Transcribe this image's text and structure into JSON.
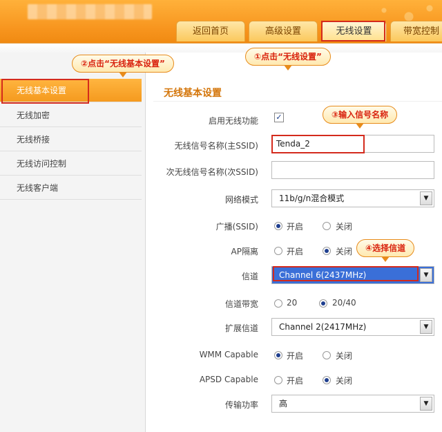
{
  "nav": {
    "tabs": [
      {
        "label": "返回首页"
      },
      {
        "label": "高级设置"
      },
      {
        "label": "无线设置"
      },
      {
        "label": "带宽控制"
      }
    ]
  },
  "sidebar": {
    "items": [
      {
        "label": "无线基本设置"
      },
      {
        "label": "无线加密"
      },
      {
        "label": "无线桥接"
      },
      {
        "label": "无线访问控制"
      },
      {
        "label": "无线客户端"
      }
    ]
  },
  "form": {
    "title": "无线基本设置",
    "enable_wireless": {
      "label": "启用无线功能",
      "checked": true,
      "mark": "✓"
    },
    "ssid_primary": {
      "label": "无线信号名称(主SSID)",
      "value": "Tenda_2"
    },
    "ssid_secondary": {
      "label": "次无线信号名称(次SSID)",
      "value": ""
    },
    "network_mode": {
      "label": "网络模式",
      "value": "11b/g/n混合模式"
    },
    "broadcast": {
      "label": "广播(SSID)",
      "options": [
        "开启",
        "关闭"
      ],
      "selected": "开启"
    },
    "ap_isolation": {
      "label": "AP隔离",
      "options": [
        "开启",
        "关闭"
      ],
      "selected": "关闭"
    },
    "channel": {
      "label": "信道",
      "value": "Channel 6(2437MHz)"
    },
    "bandwidth": {
      "label": "信道带宽",
      "options": [
        "20",
        "20/40"
      ],
      "selected": "20/40"
    },
    "ext_channel": {
      "label": "扩展信道",
      "value": "Channel 2(2417MHz)"
    },
    "wmm": {
      "label": "WMM Capable",
      "options": [
        "开启",
        "关闭"
      ],
      "selected": "开启"
    },
    "apsd": {
      "label": "APSD Capable",
      "options": [
        "开启",
        "关闭"
      ],
      "selected": "关闭"
    },
    "tx_power": {
      "label": "传输功率",
      "value": "高"
    }
  },
  "annotations": {
    "step1": "①点击“无线设置”",
    "step2": "②点击“无线基本设置”",
    "step3": "③输入信号名称",
    "step4": "④选择信道"
  },
  "colors": {
    "header": "#f7941d",
    "accent": "#d4760b",
    "annotation_red": "#d42a1c"
  }
}
